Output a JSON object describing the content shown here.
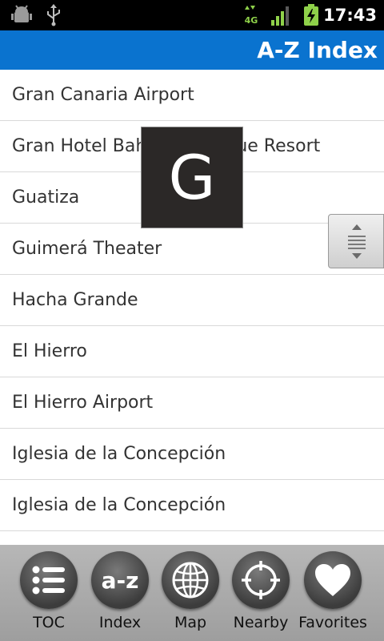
{
  "status_bar": {
    "time": "17:43",
    "network": "4G"
  },
  "title_bar": {
    "title": "A-Z Index"
  },
  "list": {
    "items": [
      "Gran Canaria Airport",
      "Gran Hotel Bahía del Duque Resort",
      "Guatiza",
      "Guimerá Theater",
      "Hacha Grande",
      "El Hierro",
      "El Hierro Airport",
      "Iglesia de la Concepción",
      "Iglesia de la Concepción"
    ]
  },
  "overlay": {
    "letter": "G"
  },
  "toolbar": {
    "buttons": [
      {
        "label": "TOC",
        "icon": "list-icon"
      },
      {
        "label": "Index",
        "icon": "a-z-icon",
        "glyph": "a-z"
      },
      {
        "label": "Map",
        "icon": "globe-icon"
      },
      {
        "label": "Nearby",
        "icon": "crosshair-icon"
      },
      {
        "label": "Favorites",
        "icon": "heart-icon"
      }
    ]
  },
  "colors": {
    "title_bar": "#0a73cf",
    "status_bar": "#000000",
    "toolbar": "#a9a9a9"
  }
}
